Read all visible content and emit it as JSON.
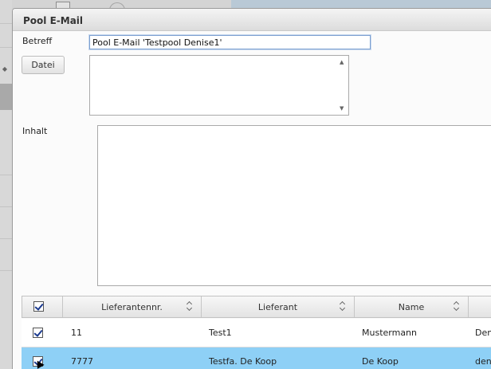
{
  "dialog": {
    "title": "Pool E-Mail"
  },
  "form": {
    "subject_label": "Betreff",
    "subject_value": "Pool E-Mail 'Testpool Denise1'",
    "file_button": "Datei",
    "content_label": "Inhalt"
  },
  "grid": {
    "columns": [
      "Lieferantennr.",
      "Lieferant",
      "Name",
      ""
    ],
    "rows": [
      {
        "checked": true,
        "nr": "11",
        "lieferant": "Test1",
        "name": "Mustermann",
        "extra": "Den",
        "selected": false
      },
      {
        "checked": true,
        "nr": "7777",
        "lieferant": "Testfa. De Koop",
        "name": "De Koop",
        "extra": "den",
        "selected": true
      }
    ]
  },
  "icons": {
    "sort": "sort-updown-icon",
    "scroll_up": "scroll-up-arrow-icon",
    "scroll_down": "scroll-down-arrow-icon",
    "checkbox": "checkbox-checked-icon"
  },
  "colors": {
    "selection": "#8ed0f6",
    "focus_border": "#7b9fd0",
    "check_mark": "#1b3a8f"
  }
}
